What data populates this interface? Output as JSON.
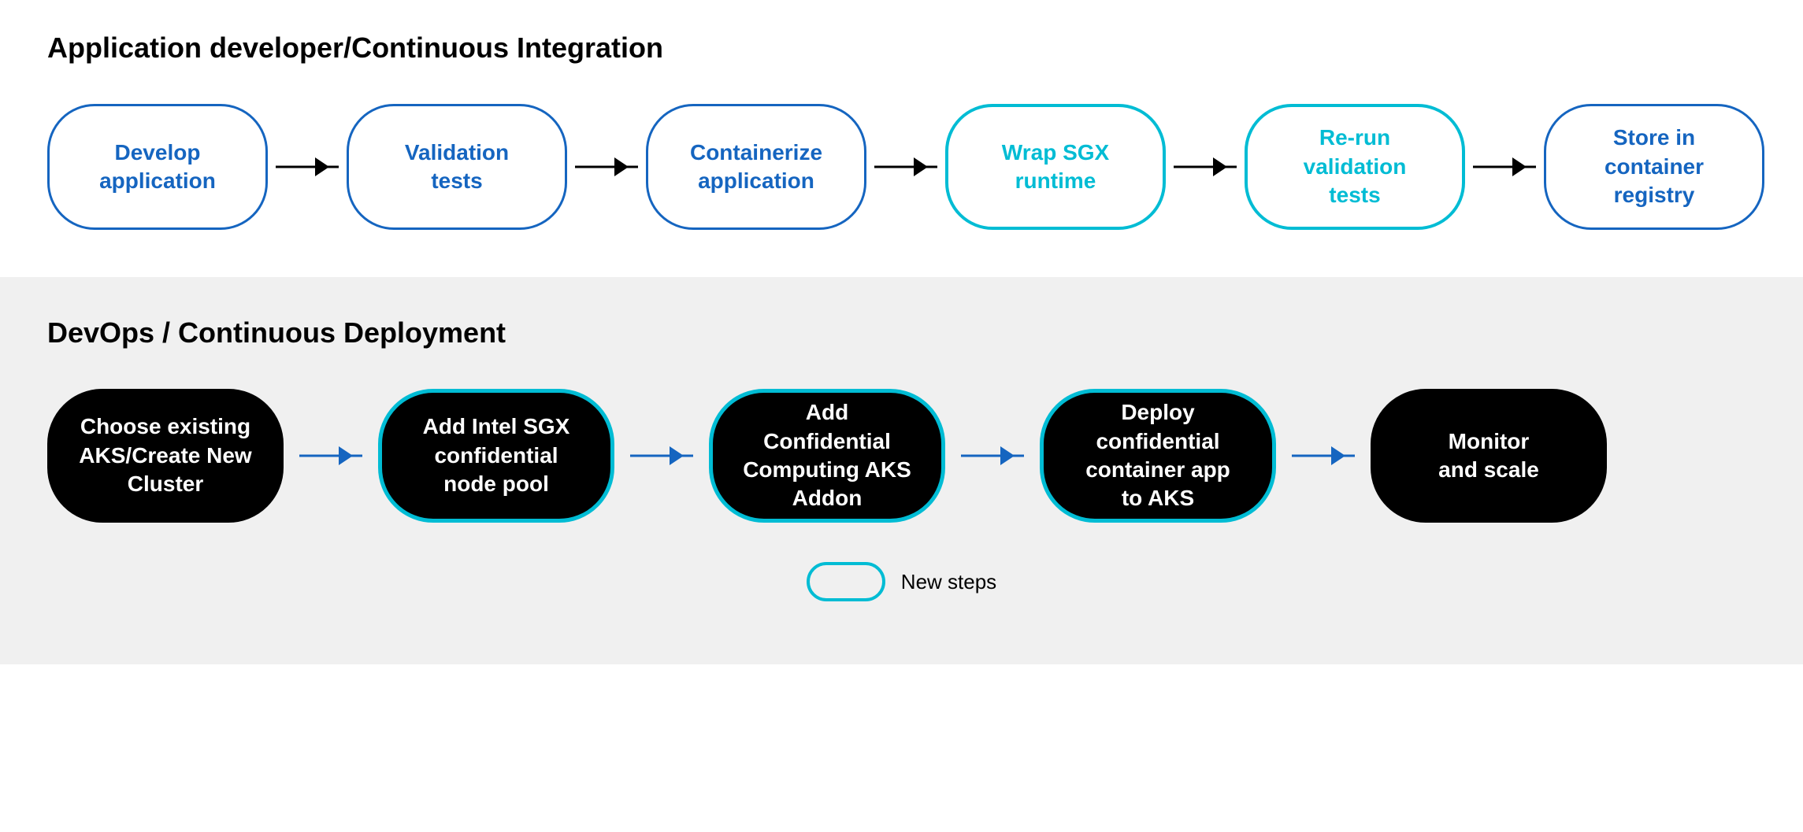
{
  "topSection": {
    "title": "Application developer/Continuous Integration",
    "nodes": [
      {
        "label": "Develop\napplication",
        "type": "normal"
      },
      {
        "label": "Validation\ntests",
        "type": "normal"
      },
      {
        "label": "Containerize\napplication",
        "type": "normal"
      },
      {
        "label": "Wrap SGX\nruntime",
        "type": "cyan"
      },
      {
        "label": "Re-run\nvalidation\ntests",
        "type": "cyan"
      },
      {
        "label": "Store in\ncontainer\nregistry",
        "type": "normal"
      }
    ]
  },
  "bottomSection": {
    "title": "DevOps / Continuous Deployment",
    "nodes": [
      {
        "label": "Choose existing\nAKS/Create New\nCluster",
        "type": "normal"
      },
      {
        "label": "Add Intel SGX\nconfidential\nnode pool",
        "type": "cyan"
      },
      {
        "label": "Add\nConfidential\nComputing AKS\nAddon",
        "type": "cyan"
      },
      {
        "label": "Deploy\nconfidential\ncontainer app\nto AKS",
        "type": "cyan"
      },
      {
        "label": "Monitor\nand scale",
        "type": "normal"
      }
    ]
  },
  "legend": {
    "label": "New steps"
  }
}
